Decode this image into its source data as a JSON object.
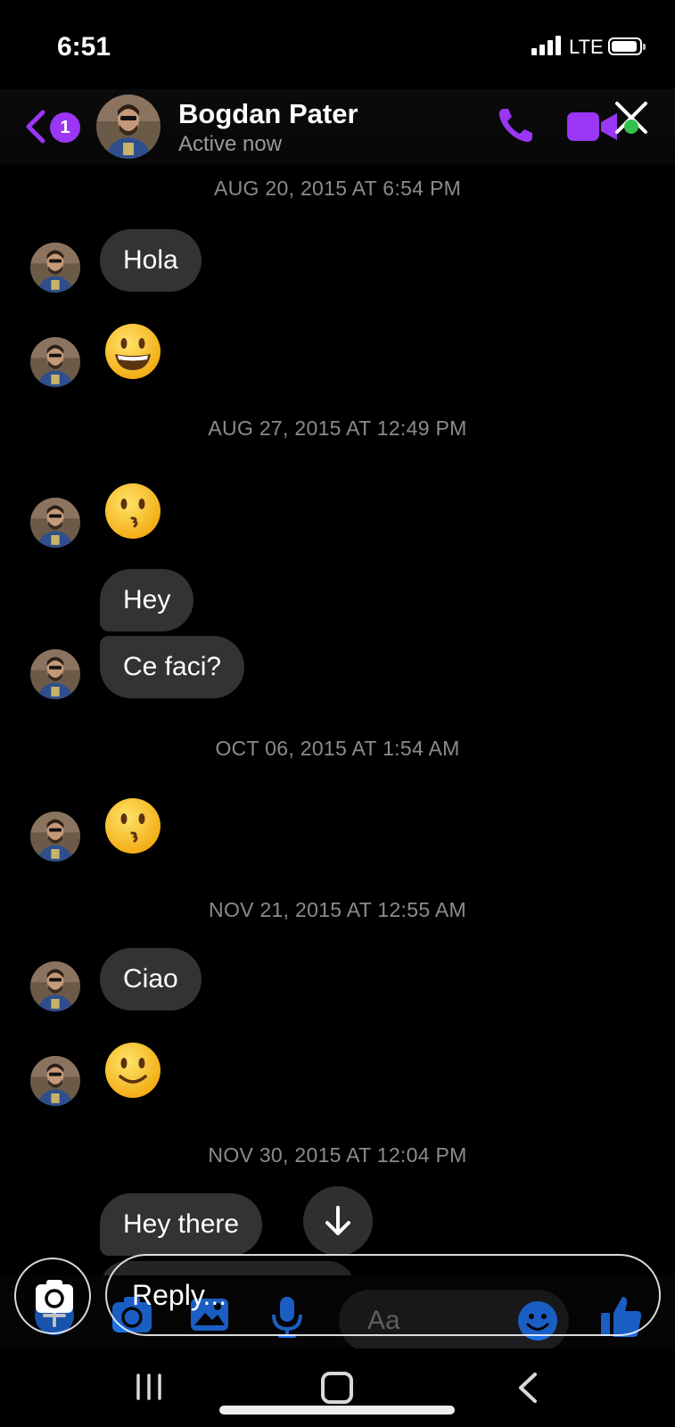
{
  "status_bar": {
    "time": "6:51",
    "network": "LTE"
  },
  "header": {
    "unread_badge": "1",
    "contact_name": "Bogdan Pater",
    "contact_status": "Active now"
  },
  "conversation": {
    "timestamps": [
      "AUG 20, 2015 AT 6:54 PM",
      "AUG 27, 2015 AT 12:49 PM",
      "OCT 06, 2015 AT 1:54 AM",
      "NOV 21, 2015 AT 12:55 AM",
      "NOV 30, 2015 AT 12:04 PM"
    ],
    "messages": [
      {
        "type": "text",
        "text": "Hola"
      },
      {
        "type": "emoji",
        "emoji": "grinning-face"
      },
      {
        "type": "emoji",
        "emoji": "kissing-face"
      },
      {
        "type": "text",
        "text": "Hey"
      },
      {
        "type": "text",
        "text": "Ce faci?"
      },
      {
        "type": "emoji",
        "emoji": "kissing-face"
      },
      {
        "type": "text",
        "text": "Ciao"
      },
      {
        "type": "emoji",
        "emoji": "slightly-smiling-face"
      },
      {
        "type": "text",
        "text": "Hey there"
      }
    ]
  },
  "composer": {
    "reply_placeholder": "Reply...",
    "message_placeholder": "Aa"
  },
  "colors": {
    "accent": "#9b36f5",
    "bubble": "#333335",
    "timestamp": "#8b8b8f",
    "messenger_blue": "#1f6fe5"
  }
}
